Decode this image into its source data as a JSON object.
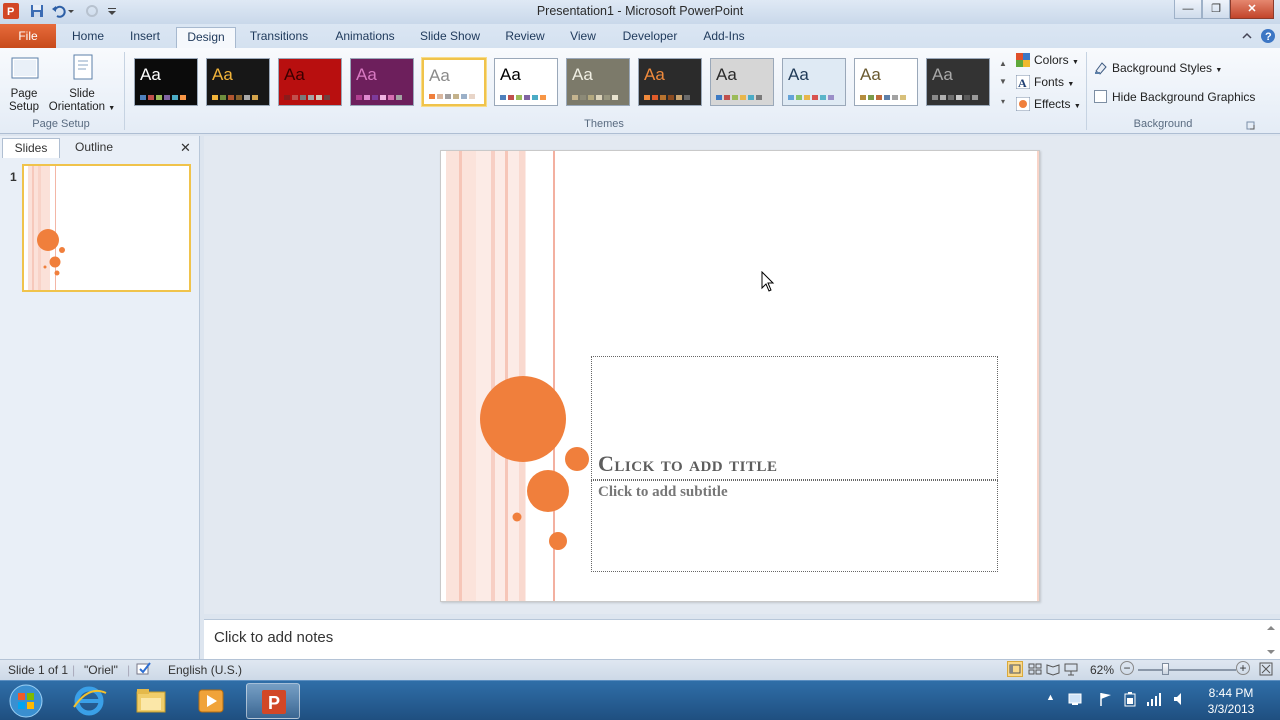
{
  "window": {
    "title": "Presentation1  -  Microsoft PowerPoint",
    "controls": {
      "minimize": "—",
      "maximize": "❐",
      "close": "✕"
    }
  },
  "ribbon_tabs": [
    "File",
    "Home",
    "Insert",
    "Design",
    "Transitions",
    "Animations",
    "Slide Show",
    "Review",
    "View",
    "Developer",
    "Add-Ins"
  ],
  "active_tab": "Design",
  "page_setup": {
    "page_setup_label": "Page\nSetup",
    "page_setup_l1": "Page",
    "page_setup_l2": "Setup",
    "orientation_l1": "Slide",
    "orientation_l2": "Orientation",
    "group_label": "Page Setup"
  },
  "themes": {
    "group_label": "Themes",
    "items": [
      {
        "sample": "Aa",
        "bg": "#0b0b0b",
        "fg": "#ffffff"
      },
      {
        "sample": "Aa",
        "bg": "#171717",
        "fg": "#f2b43a"
      },
      {
        "sample": "Aa",
        "bg": "#b80f0f",
        "fg": "#3a0000"
      },
      {
        "sample": "Aa",
        "bg": "#6d1f5c",
        "fg": "#d879c2"
      },
      {
        "sample": "Aa",
        "bg": "#ffffff",
        "fg": "#8a8a8a"
      },
      {
        "sample": "Aa",
        "bg": "#ffffff",
        "fg": "#000000"
      },
      {
        "sample": "Aa",
        "bg": "#7c7a6a",
        "fg": "#f0efe3"
      },
      {
        "sample": "Aa",
        "bg": "#2b2b2b",
        "fg": "#f08a3c"
      },
      {
        "sample": "Aa",
        "bg": "#d6d6d6",
        "fg": "#2a2a2a"
      },
      {
        "sample": "Aa",
        "bg": "#dfeaf4",
        "fg": "#1f3a57"
      },
      {
        "sample": "Aa",
        "bg": "#ffffff",
        "fg": "#6a5a30"
      },
      {
        "sample": "Aa",
        "bg": "#333333",
        "fg": "#a9a9a9"
      }
    ],
    "selected_index": 4,
    "colors_label": "Colors",
    "fonts_label": "Fonts",
    "effects_label": "Effects"
  },
  "background": {
    "group_label": "Background",
    "styles_label": "Background Styles",
    "hide_graphics_label": "Hide Background Graphics",
    "hide_graphics_checked": false
  },
  "left_panel": {
    "tabs": [
      "Slides",
      "Outline"
    ],
    "close": "✕",
    "slide_number": "1"
  },
  "slide": {
    "title_placeholder": "Click to add title",
    "subtitle_placeholder": "Click to add subtitle",
    "accent": "#f07f3c"
  },
  "notes": {
    "placeholder": "Click to add notes"
  },
  "status": {
    "slide_info": "Slide 1 of 1",
    "theme": "\"Oriel\"",
    "language": "English (U.S.)",
    "zoom": "62%",
    "zoom_minus": "−",
    "zoom_plus": "+"
  },
  "taskbar": {
    "time": "8:44 PM",
    "date": "3/3/2013"
  }
}
